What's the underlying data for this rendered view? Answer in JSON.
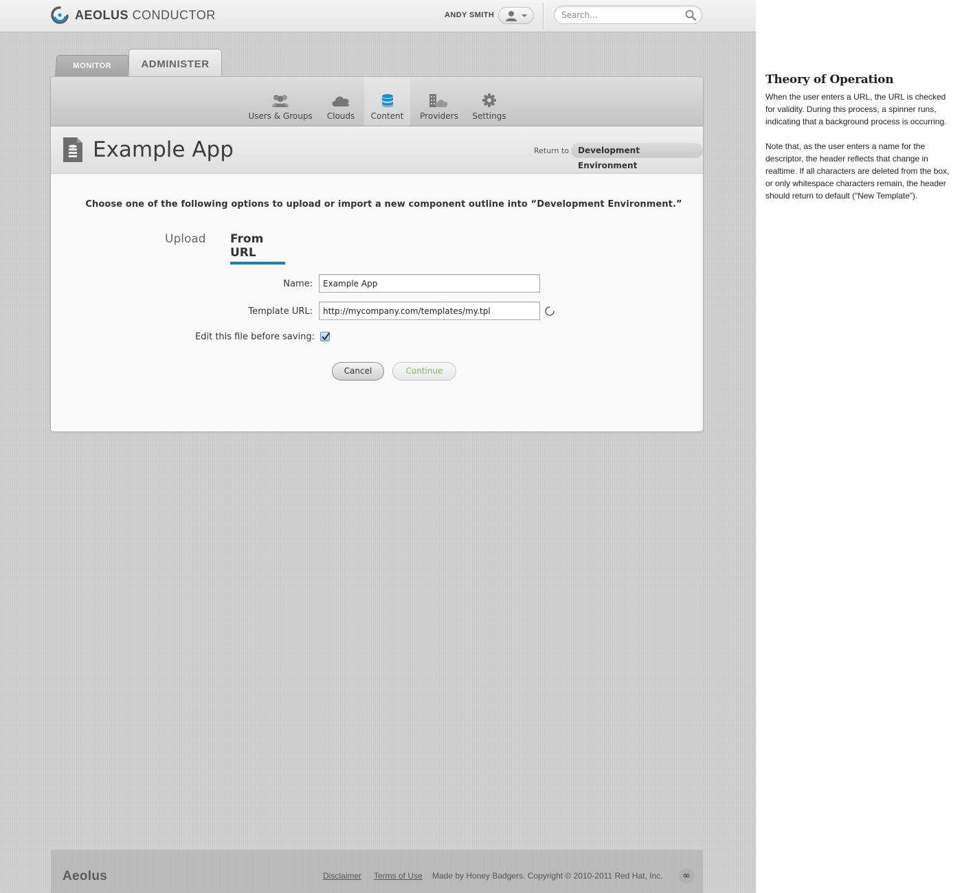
{
  "header": {
    "brand_bold": "AEOLUS",
    "brand_light": "CONDUCTOR",
    "username": "ANDY SMITH",
    "search_placeholder": "Search..."
  },
  "main_tabs": [
    {
      "label": "MONITOR",
      "active": false
    },
    {
      "label": "ADMINISTER",
      "active": true
    }
  ],
  "subnav": {
    "items": [
      {
        "label": "Users & Groups",
        "icon": "users-icon"
      },
      {
        "label": "Clouds",
        "icon": "cloud-icon"
      },
      {
        "label": "Content",
        "icon": "database-icon",
        "active": true
      },
      {
        "label": "Providers",
        "icon": "providers-icon"
      },
      {
        "label": "Settings",
        "icon": "gear-icon"
      }
    ]
  },
  "titlebar": {
    "title": "Example App",
    "return_label": "Return to",
    "return_target": "Development Environment"
  },
  "content": {
    "instructions": "Choose one of the following options to upload or import a new component outline into “Development Environment.”",
    "tabs": [
      {
        "label": "Upload",
        "active": false
      },
      {
        "label": "From URL",
        "active": true
      }
    ],
    "form": {
      "name_label": "Name:",
      "name_value": "Example App",
      "url_label": "Template URL:",
      "url_value": "http://mycompany.com/templates/my.tpl",
      "edit_label": "Edit this file before saving:",
      "edit_checked": true
    },
    "buttons": {
      "cancel": "Cancel",
      "continue": "Continue"
    }
  },
  "footer": {
    "brand": "Aeolus",
    "disclaimer": "Disclaimer",
    "terms": "Terms of Use",
    "copyright": "Made by Honey Badgers. Copyright © 2010-2011 Red Hat, Inc.",
    "badge": "∞"
  },
  "notes": {
    "title": "Theory of Operation",
    "paragraphs": [
      "When the user enters a URL, the URL is checked for validity. During this process, a spinner runs, indicating that a background process is occurring.",
      "Note that, as the user enters a name for the descriptor, the header reflects that change in realtime. If all characters are deleted from the box, or only whitespace characters remain, the header should return to default (“New Template”)."
    ]
  },
  "colors": {
    "accent": "#1a7fb8",
    "continue_text": "#7fbf4a"
  }
}
